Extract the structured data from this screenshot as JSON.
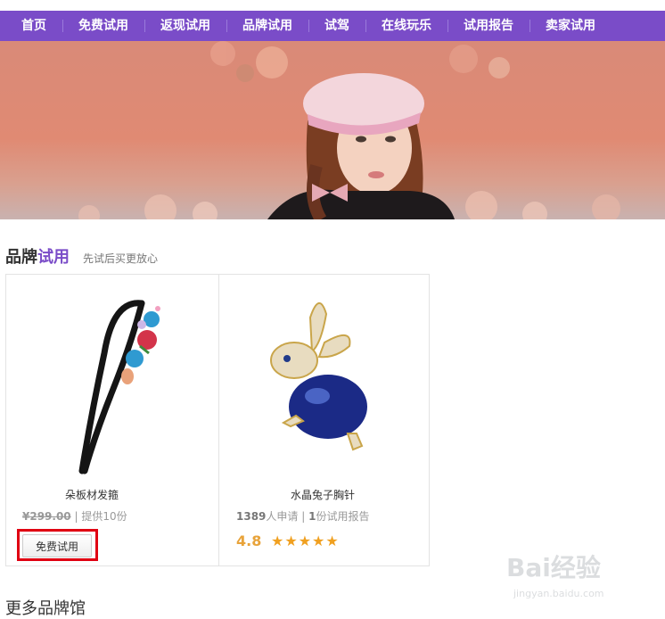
{
  "nav": {
    "items": [
      "首页",
      "免费试用",
      "返现试用",
      "品牌试用",
      "试驾",
      "在线玩乐",
      "试用报告",
      "卖家试用"
    ]
  },
  "section": {
    "title_main": "品牌",
    "title_highlight": "试用",
    "subtitle": "先试后买更放心"
  },
  "products": [
    {
      "name": "朵板材发箍",
      "price": "¥299.00",
      "meta_sep": " | ",
      "supply": "提供10份",
      "button_label": "免费试用"
    },
    {
      "name": "水晶兔子胸针",
      "applicants": "1389",
      "applicants_label": "人申请",
      "reports": "1",
      "reports_label": "份试用报告",
      "rating": "4.8",
      "stars": "★★★★★",
      "rating_value": 4.8
    }
  ],
  "more": {
    "title": "更多品牌馆"
  },
  "watermark": {
    "logo": "Bai经验",
    "url": "jingyan.baidu.com"
  },
  "colors": {
    "nav": "#7a4cc8",
    "highlight": "#e00012",
    "accent": "#7a4cc8",
    "rating": "#e8a33a"
  }
}
